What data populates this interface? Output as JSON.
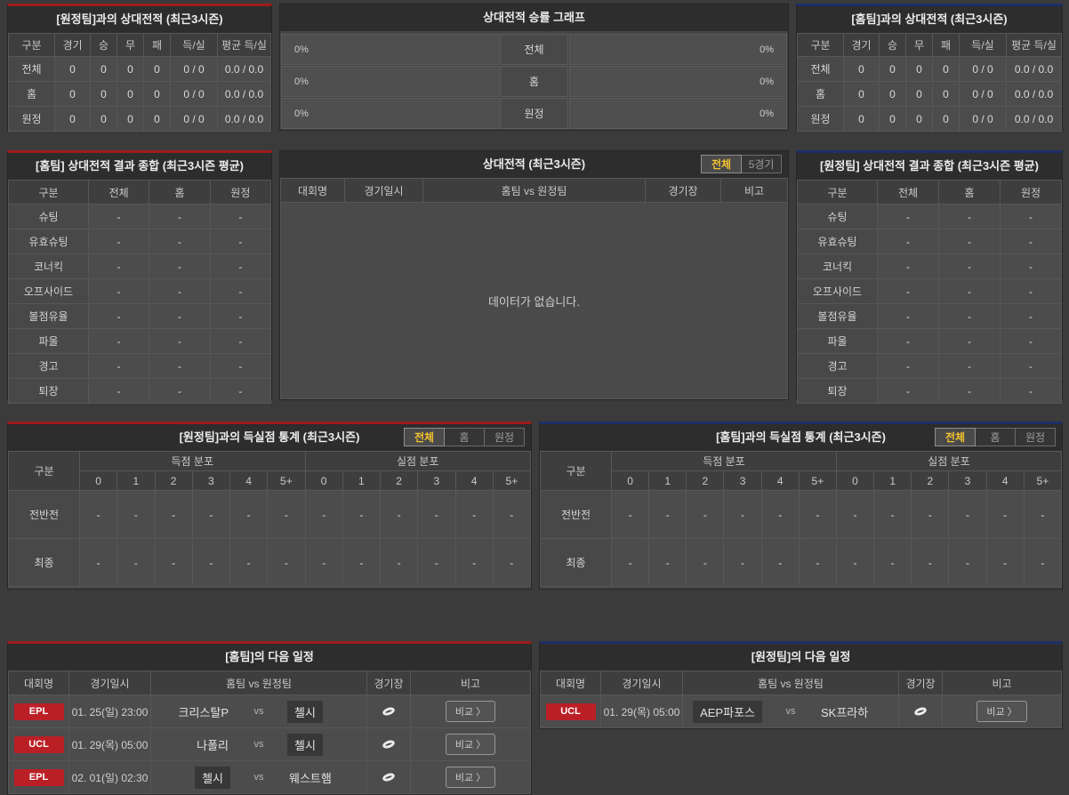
{
  "colors": {
    "accent_red": "#9e1b1b",
    "accent_blue": "#1e2f66",
    "active_tab_gold": "#f2c231",
    "league_badge_red": "#bb1f26"
  },
  "h2h_away": {
    "title": "[원정팀]과의 상대전적 (최근3시즌)",
    "headers": [
      "구분",
      "경기",
      "승",
      "무",
      "패",
      "득/실",
      "평균 득/실"
    ],
    "rows": [
      {
        "label": "전체",
        "values": [
          "0",
          "0",
          "0",
          "0",
          "0 / 0",
          "0.0 / 0.0"
        ]
      },
      {
        "label": "홈",
        "values": [
          "0",
          "0",
          "0",
          "0",
          "0 / 0",
          "0.0 / 0.0"
        ]
      },
      {
        "label": "원정",
        "values": [
          "0",
          "0",
          "0",
          "0",
          "0 / 0",
          "0.0 / 0.0"
        ]
      }
    ]
  },
  "winrate_graph": {
    "title": "상대전적 승률 그래프",
    "rows": [
      {
        "left_value": "0%",
        "label": "전체",
        "right_value": "0%"
      },
      {
        "left_value": "0%",
        "label": "홈",
        "right_value": "0%"
      },
      {
        "left_value": "0%",
        "label": "원정",
        "right_value": "0%"
      }
    ]
  },
  "h2h_home": {
    "title": "[홈팀]과의 상대전적 (최근3시즌)",
    "headers": [
      "구분",
      "경기",
      "승",
      "무",
      "패",
      "득/실",
      "평균 득/실"
    ],
    "rows": [
      {
        "label": "전체",
        "values": [
          "0",
          "0",
          "0",
          "0",
          "0 / 0",
          "0.0 / 0.0"
        ]
      },
      {
        "label": "홈",
        "values": [
          "0",
          "0",
          "0",
          "0",
          "0 / 0",
          "0.0 / 0.0"
        ]
      },
      {
        "label": "원정",
        "values": [
          "0",
          "0",
          "0",
          "0",
          "0 / 0",
          "0.0 / 0.0"
        ]
      }
    ]
  },
  "summary_home": {
    "title": "[홈팀] 상대전적 결과 종합 (최근3시즌 평균)",
    "headers": [
      "구분",
      "전체",
      "홈",
      "원정"
    ],
    "rows": [
      {
        "label": "슈팅",
        "values": [
          "-",
          "-",
          "-"
        ]
      },
      {
        "label": "유효슈팅",
        "values": [
          "-",
          "-",
          "-"
        ]
      },
      {
        "label": "코너킥",
        "values": [
          "-",
          "-",
          "-"
        ]
      },
      {
        "label": "오프사이드",
        "values": [
          "-",
          "-",
          "-"
        ]
      },
      {
        "label": "볼점유율",
        "values": [
          "-",
          "-",
          "-"
        ]
      },
      {
        "label": "파울",
        "values": [
          "-",
          "-",
          "-"
        ]
      },
      {
        "label": "경고",
        "values": [
          "-",
          "-",
          "-"
        ]
      },
      {
        "label": "퇴장",
        "values": [
          "-",
          "-",
          "-"
        ]
      }
    ]
  },
  "h2h_list": {
    "title": "상대전적 (최근3시즌)",
    "tabs": [
      "전체",
      "5경기"
    ],
    "active_tab": "전체",
    "headers": [
      "대회명",
      "경기일시",
      "홈팀 vs 원정팀",
      "경기장",
      "비고"
    ],
    "empty_message": "데이터가 없습니다."
  },
  "summary_away": {
    "title": "[원정팀] 상대전적 결과 종합 (최근3시즌 평균)",
    "headers": [
      "구분",
      "전체",
      "홈",
      "원정"
    ],
    "rows": [
      {
        "label": "슈팅",
        "values": [
          "-",
          "-",
          "-"
        ]
      },
      {
        "label": "유효슈팅",
        "values": [
          "-",
          "-",
          "-"
        ]
      },
      {
        "label": "코너킥",
        "values": [
          "-",
          "-",
          "-"
        ]
      },
      {
        "label": "오프사이드",
        "values": [
          "-",
          "-",
          "-"
        ]
      },
      {
        "label": "볼점유율",
        "values": [
          "-",
          "-",
          "-"
        ]
      },
      {
        "label": "파울",
        "values": [
          "-",
          "-",
          "-"
        ]
      },
      {
        "label": "경고",
        "values": [
          "-",
          "-",
          "-"
        ]
      },
      {
        "label": "퇴장",
        "values": [
          "-",
          "-",
          "-"
        ]
      }
    ]
  },
  "goal_stats_away": {
    "title": "[원정팀]과의 득실점 통계 (최근3시즌)",
    "tabs": [
      "전체",
      "홈",
      "원정"
    ],
    "active_tab": "전체",
    "corner_label": "구분",
    "group_headers": [
      "득점 분포",
      "실점 분포"
    ],
    "bin_labels": [
      "0",
      "1",
      "2",
      "3",
      "4",
      "5+",
      "0",
      "1",
      "2",
      "3",
      "4",
      "5+"
    ],
    "rows": [
      {
        "label": "전반전",
        "values": [
          "-",
          "-",
          "-",
          "-",
          "-",
          "-",
          "-",
          "-",
          "-",
          "-",
          "-",
          "-"
        ]
      },
      {
        "label": "최종",
        "values": [
          "-",
          "-",
          "-",
          "-",
          "-",
          "-",
          "-",
          "-",
          "-",
          "-",
          "-",
          "-"
        ]
      }
    ]
  },
  "goal_stats_home": {
    "title": "[홈팀]과의 득실점 통계 (최근3시즌)",
    "tabs": [
      "전체",
      "홈",
      "원정"
    ],
    "active_tab": "전체",
    "corner_label": "구분",
    "group_headers": [
      "득점 분포",
      "실점 분포"
    ],
    "bin_labels": [
      "0",
      "1",
      "2",
      "3",
      "4",
      "5+",
      "0",
      "1",
      "2",
      "3",
      "4",
      "5+"
    ],
    "rows": [
      {
        "label": "전반전",
        "values": [
          "-",
          "-",
          "-",
          "-",
          "-",
          "-",
          "-",
          "-",
          "-",
          "-",
          "-",
          "-"
        ]
      },
      {
        "label": "최종",
        "values": [
          "-",
          "-",
          "-",
          "-",
          "-",
          "-",
          "-",
          "-",
          "-",
          "-",
          "-",
          "-"
        ]
      }
    ]
  },
  "schedule_home": {
    "title": "[홈팀]의 다음 일정",
    "headers": [
      "대회명",
      "경기일시",
      "홈팀 vs 원정팀",
      "경기장",
      "비고"
    ],
    "vs_label": "vs",
    "compare_label": "비교 〉",
    "rows": [
      {
        "league": "EPL",
        "datetime": "01. 25(일) 23:00",
        "home": "크리스탈P",
        "away": "첼시",
        "highlighted_team": "away"
      },
      {
        "league": "UCL",
        "datetime": "01. 29(목) 05:00",
        "home": "나폴리",
        "away": "첼시",
        "highlighted_team": "away"
      },
      {
        "league": "EPL",
        "datetime": "02. 01(일) 02:30",
        "home": "첼시",
        "away": "웨스트햄",
        "highlighted_team": "home"
      }
    ]
  },
  "schedule_away": {
    "title": "[원정팀]의 다음 일정",
    "headers": [
      "대회명",
      "경기일시",
      "홈팀 vs 원정팀",
      "경기장",
      "비고"
    ],
    "vs_label": "vs",
    "compare_label": "비교 〉",
    "rows": [
      {
        "league": "UCL",
        "datetime": "01. 29(목) 05:00",
        "home": "AEP파포스",
        "away": "SK프라하",
        "highlighted_team": "home"
      }
    ]
  }
}
